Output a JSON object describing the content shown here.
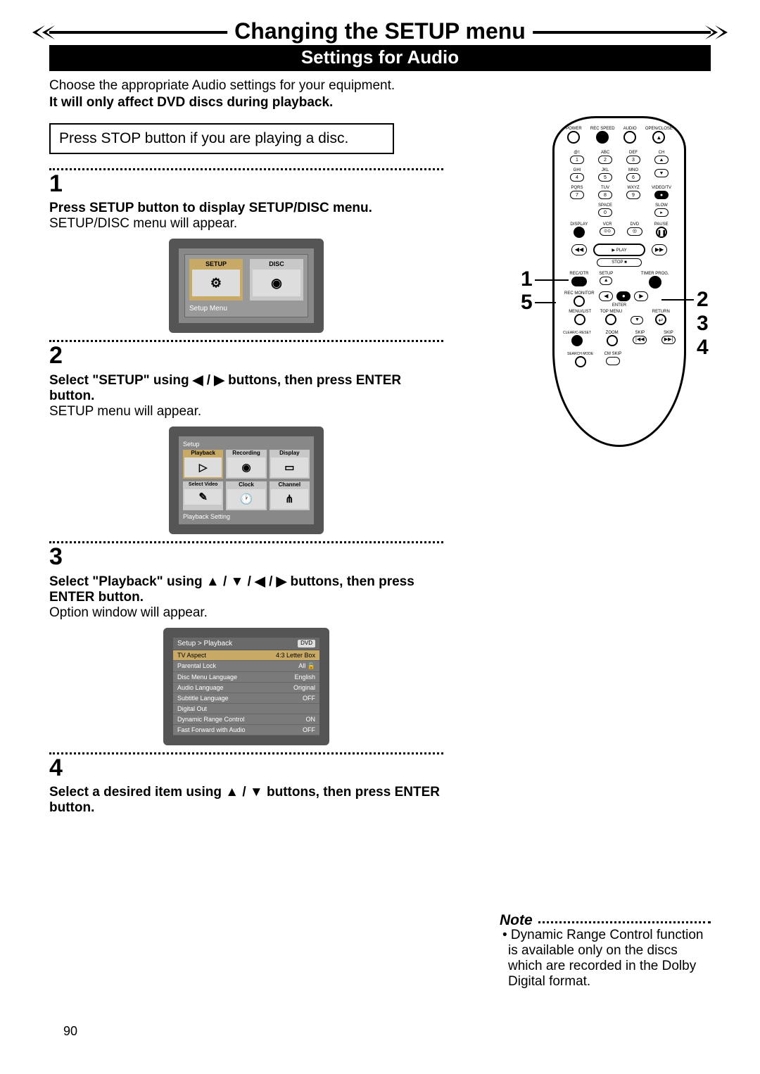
{
  "header": {
    "title": "Changing the SETUP menu",
    "subtitle": "Settings for Audio"
  },
  "intro": {
    "line1": "Choose the appropriate Audio settings for your equipment.",
    "line2": "It will only affect DVD discs during playback."
  },
  "inset": {
    "text": "Press STOP button if you are playing a disc."
  },
  "steps": {
    "s1": {
      "num": "1",
      "bold": "Press SETUP button to display SETUP/DISC menu.",
      "body": "SETUP/DISC menu will appear.",
      "tv": {
        "tab_setup": "SETUP",
        "tab_disc": "DISC",
        "caption": "Setup Menu"
      }
    },
    "s2": {
      "num": "2",
      "bold_a": "Select \"SETUP\" using ",
      "bold_b": " buttons, then press ENTER button.",
      "arrows": "◀ / ▶",
      "body": "SETUP menu will appear.",
      "tv": {
        "hdr": "Setup",
        "tiles": [
          "Playback",
          "Recording",
          "Display",
          "Select Video",
          "Clock",
          "Channel"
        ],
        "foot": "Playback Setting"
      }
    },
    "s3": {
      "num": "3",
      "bold_a": "Select \"Playback\" using ",
      "bold_b": " buttons, then press ENTER button.",
      "arrows": "▲ / ▼ / ◀ / ▶",
      "body": "Option window will appear.",
      "tv": {
        "breadcrumb": "Setup > Playback",
        "badge": "DVD",
        "rows": [
          {
            "k": "TV Aspect",
            "v": "4:3 Letter Box"
          },
          {
            "k": "Parental Lock",
            "v": "All  🔓"
          },
          {
            "k": "Disc Menu Language",
            "v": "English"
          },
          {
            "k": "Audio Language",
            "v": "Original"
          },
          {
            "k": "Subtitle Language",
            "v": "OFF"
          },
          {
            "k": "Digital Out",
            "v": ""
          },
          {
            "k": "Dynamic Range Control",
            "v": "ON"
          },
          {
            "k": "Fast Forward with Audio",
            "v": "OFF"
          }
        ]
      }
    },
    "s4": {
      "num": "4",
      "bold_a": "Select a desired item using ",
      "bold_b": " buttons, then press ENTER button.",
      "arrows": "▲ / ▼"
    }
  },
  "remote": {
    "top": [
      "POWER",
      "REC SPEED",
      "AUDIO",
      "OPEN/CLOSE"
    ],
    "numpad": [
      {
        "t": "@!:",
        "n": "1"
      },
      {
        "t": "ABC",
        "n": "2"
      },
      {
        "t": "DEF",
        "n": "3"
      },
      {
        "t": "CH",
        "n": "▲"
      },
      {
        "t": "GHI",
        "n": "4"
      },
      {
        "t": "JKL",
        "n": "5"
      },
      {
        "t": "MNO",
        "n": "6"
      },
      {
        "t": "",
        "n": "▼"
      },
      {
        "t": "PQRS",
        "n": "7"
      },
      {
        "t": "TUV",
        "n": "8"
      },
      {
        "t": "WXYZ",
        "n": "9"
      },
      {
        "t": "VIDEO/TV",
        "n": "●"
      },
      {
        "t": "",
        "n": ""
      },
      {
        "t": "SPACE",
        "n": "0"
      },
      {
        "t": "",
        "n": ""
      },
      {
        "t": "SLOW",
        "n": "▸"
      }
    ],
    "row_disp": [
      "DISPLAY",
      "VCR",
      "DVD",
      "PAUSE"
    ],
    "play": "▶  PLAY",
    "stop": "STOP ■",
    "rec_row": [
      "REC/OTR",
      "SETUP",
      "",
      "TIMER PROG."
    ],
    "recmon": "REC MONITOR",
    "enter": "ENTER",
    "menu_row": [
      "MENU/LIST",
      "TOP MENU",
      "",
      "RETURN"
    ],
    "bottom_row": [
      "CLEAR/C-RESET",
      "ZOOM",
      "SKIP",
      "SKIP"
    ],
    "last_row": [
      "SEARCH MODE",
      "CM SKIP"
    ]
  },
  "callouts": {
    "left_top": "1",
    "left_bot": "5",
    "right_1": "2",
    "right_2": "3",
    "right_3": "4"
  },
  "note": {
    "title": "Note",
    "body": "• Dynamic Range Control function is available only on the discs which are recorded in the Dolby Digital format."
  },
  "page_number": "90"
}
